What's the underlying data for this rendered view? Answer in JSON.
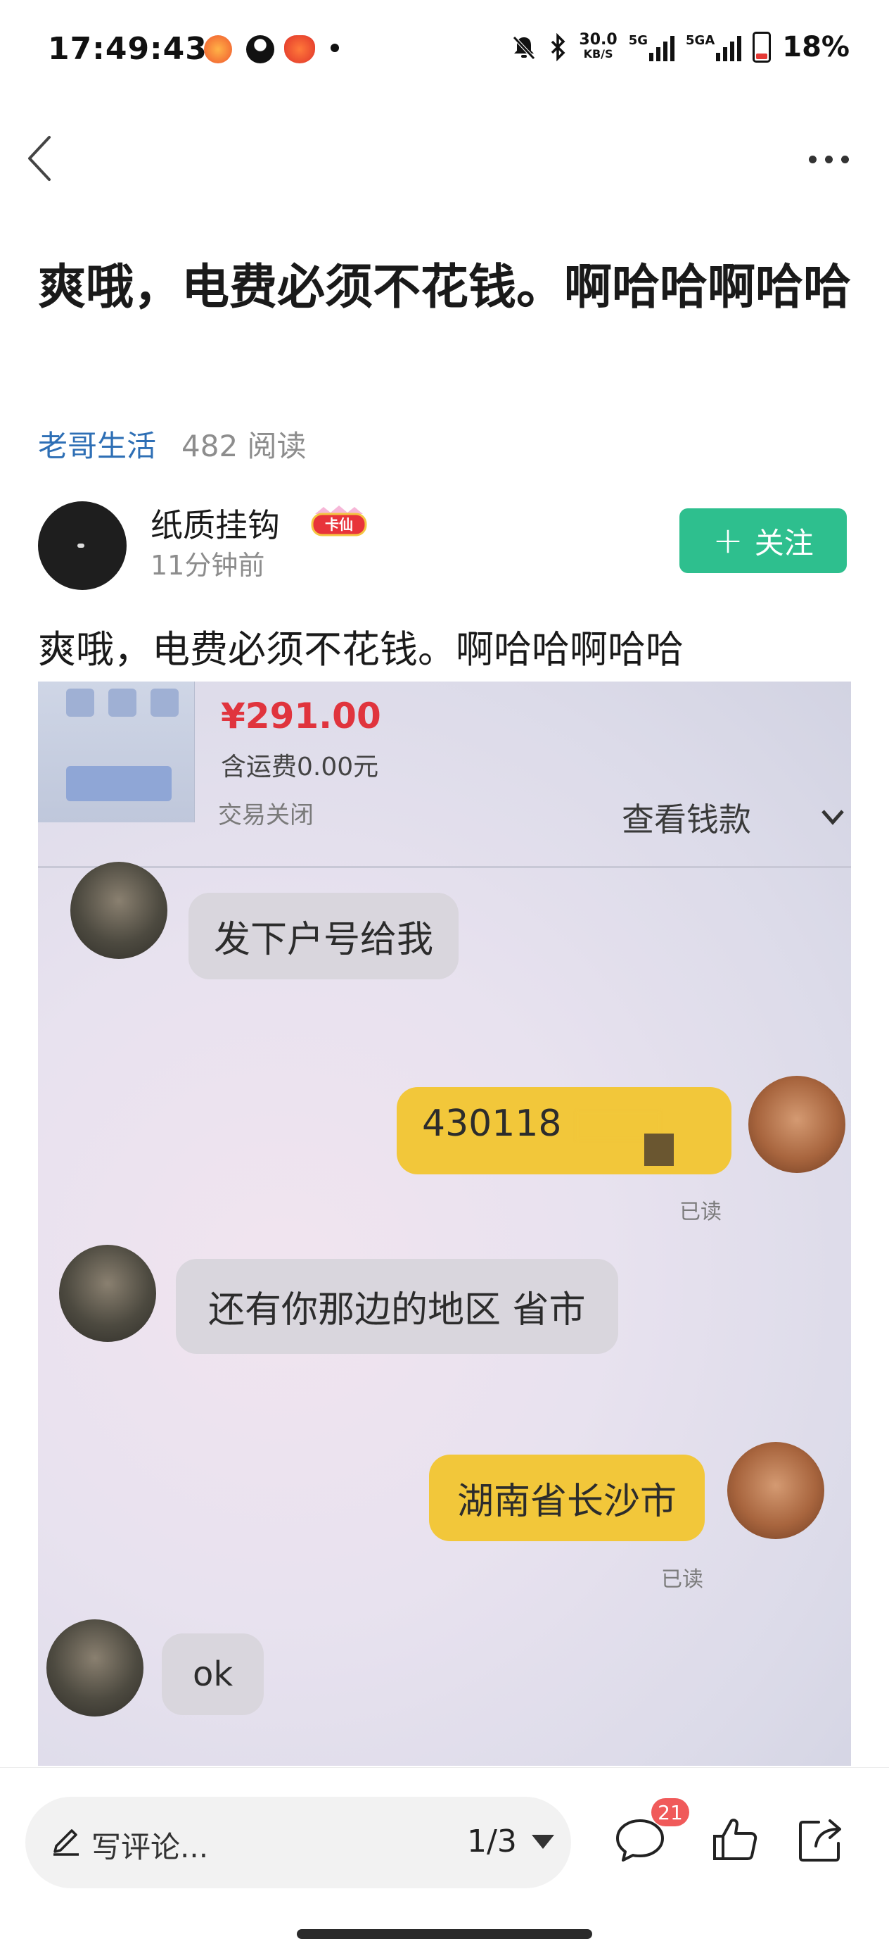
{
  "status_bar": {
    "time": "17:49:43",
    "net_speed_value": "30.0",
    "net_speed_unit": "KB/S",
    "signal_label_1": "5G",
    "signal_label_2": "5GA",
    "battery": "18%"
  },
  "article": {
    "title": "爽哦，电费必须不花钱。啊哈哈啊哈哈",
    "topic": "老哥生活",
    "reads": "482 阅读",
    "author_name": "纸质挂钩",
    "author_badge": "卡仙",
    "post_time": "11分钟前",
    "follow_label": "关注",
    "body": "爽哦，电费必须不花钱。啊哈哈啊哈哈"
  },
  "photo": {
    "price": "¥291.00",
    "shipping": "含运费0.00元",
    "status": "交易关闭",
    "view_link": "查看钱款",
    "messages": [
      {
        "side": "in",
        "text": "发下户号给我"
      },
      {
        "side": "out",
        "text": "430118",
        "read": "已读"
      },
      {
        "side": "in",
        "text": "还有你那边的地区 省市"
      },
      {
        "side": "out",
        "text": "湖南省长沙市",
        "read": "已读"
      },
      {
        "side": "in",
        "text": "ok"
      }
    ]
  },
  "bottom_bar": {
    "comment_placeholder": "写评论...",
    "page_indicator": "1/3",
    "comment_count": "21"
  }
}
